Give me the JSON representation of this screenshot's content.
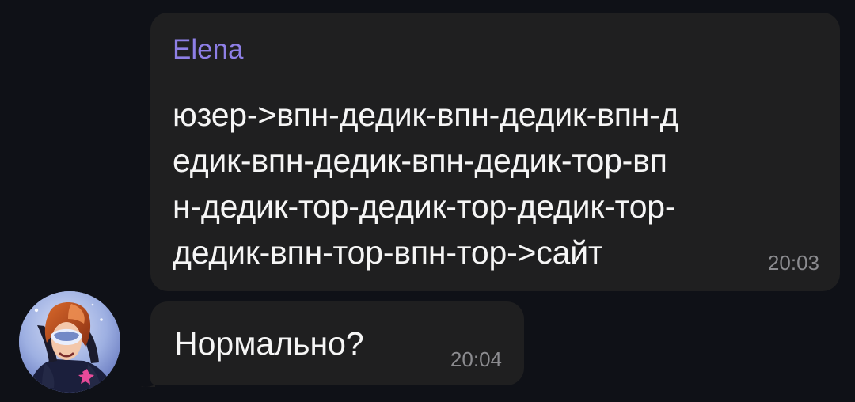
{
  "messages": [
    {
      "sender": "Elena",
      "lines": [
        "юзер->впн-дедик-впн-дедик-впн-д",
        "едик-впн-дедик-впн-дедик-тор-вп",
        "н-дедик-тор-дедик-тор-дедик-тор-",
        "дедик-впн-тор-впн-тор->сайт"
      ],
      "time": "20:03"
    },
    {
      "text": "Нормально?",
      "time": "20:04"
    }
  ],
  "colors": {
    "background": "#0f1117",
    "bubble": "#1f1f20",
    "sender_name": "#8e7fe6",
    "timestamp": "#8b8b8f"
  },
  "icons": {
    "avatar": "illustrated-avatar-icon"
  }
}
